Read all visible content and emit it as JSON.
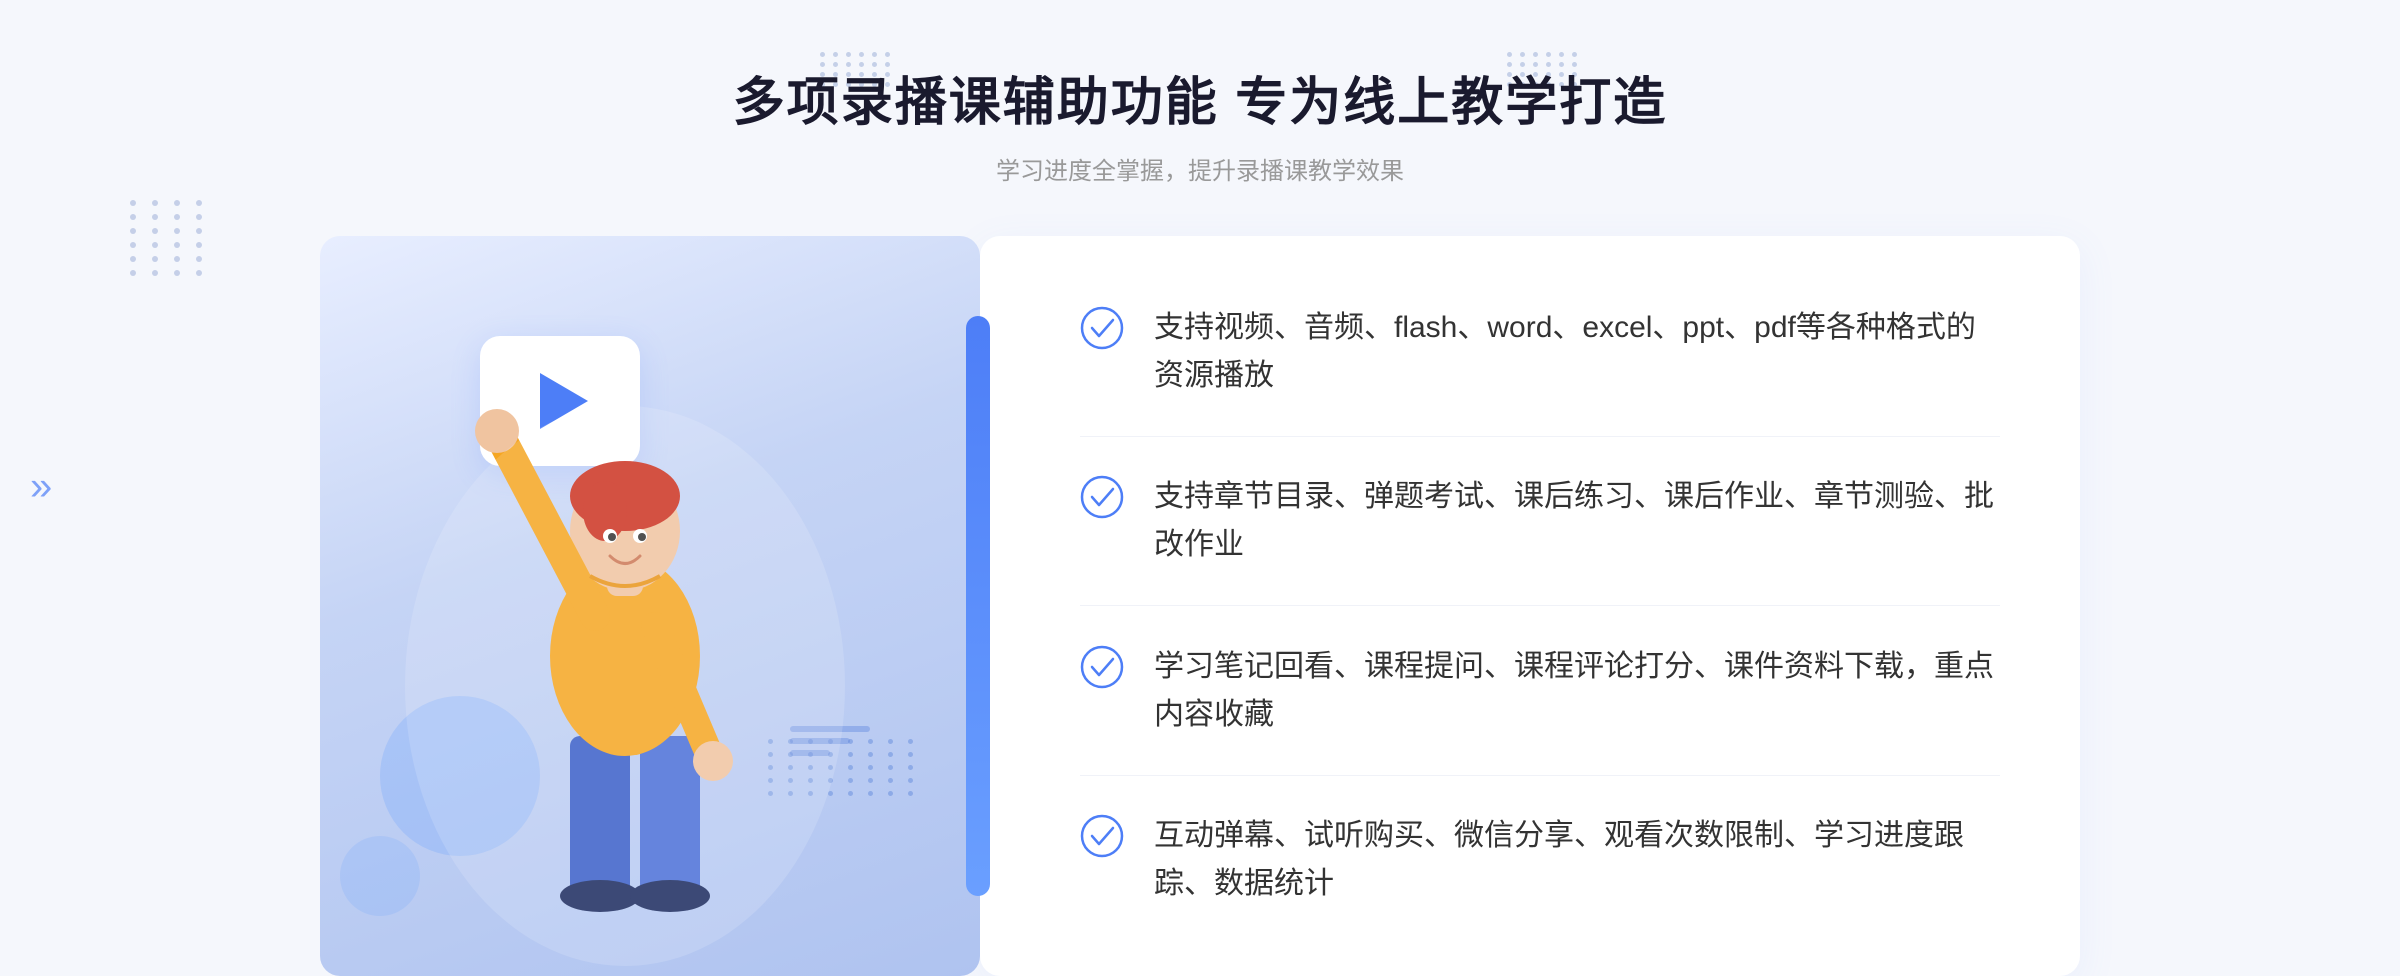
{
  "header": {
    "main_title": "多项录播课辅助功能 专为线上教学打造",
    "sub_title": "学习进度全掌握，提升录播课教学效果"
  },
  "features": [
    {
      "id": "feature-1",
      "text": "支持视频、音频、flash、word、excel、ppt、pdf等各种格式的资源播放"
    },
    {
      "id": "feature-2",
      "text": "支持章节目录、弹题考试、课后练习、课后作业、章节测验、批改作业"
    },
    {
      "id": "feature-3",
      "text": "学习笔记回看、课程提问、课程评论打分、课件资料下载，重点内容收藏"
    },
    {
      "id": "feature-4",
      "text": "互动弹幕、试听购买、微信分享、观看次数限制、学习进度跟踪、数据统计"
    }
  ],
  "colors": {
    "primary_blue": "#4d7ef7",
    "light_blue": "#6a9fff",
    "check_color": "#4d7ef7",
    "text_dark": "#333333",
    "text_gray": "#999999"
  },
  "decorations": {
    "left_arrow": "»",
    "dots_grid_count": 24,
    "stripe_widths": [
      80,
      60,
      40
    ]
  }
}
